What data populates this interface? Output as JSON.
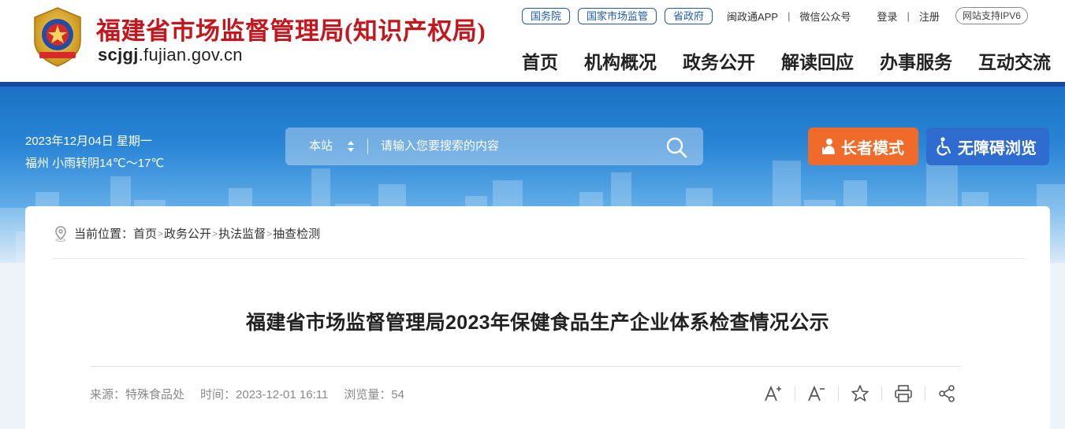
{
  "site": {
    "title": "福建省市场监督管理局(知识产权局)",
    "domain_a": "scjgj",
    "domain_b": ".fujian.gov.cn"
  },
  "toplinks": {
    "pills": [
      "国务院",
      "国家市场监管",
      "省政府"
    ],
    "app": "闽政通APP",
    "wechat": "微信公众号",
    "login": "登录",
    "register": "注册",
    "ipv6": "网站支持IPV6",
    "sep": "|"
  },
  "nav": [
    "首页",
    "机构概况",
    "政务公开",
    "解读回应",
    "办事服务",
    "互动交流"
  ],
  "banner": {
    "date": "2023年12月04日 星期一",
    "weather": "福州 小雨转阴14℃～17℃",
    "search_scope": "本站",
    "search_placeholder": "请输入您要搜索的内容",
    "elder_mode": "长者模式",
    "accessible": "无障碍浏览"
  },
  "breadcrumb": {
    "prefix": "当前位置：",
    "items": [
      "首页",
      "政务公开",
      "执法监督",
      "抽查检测"
    ],
    "sep": ">"
  },
  "article": {
    "title": "福建省市场监督管理局2023年保健食品生产企业体系检查情况公示",
    "source": "来源：特殊食品处",
    "time": "时间：2023-12-01 16:11",
    "views": "浏览量：54"
  },
  "tools": [
    "font-larger-icon",
    "font-smaller-icon",
    "favorite-icon",
    "print-icon",
    "share-icon"
  ],
  "colors": {
    "brand_red": "#c4161c",
    "brand_blue": "#1f5bb0",
    "elder_orange": "#f06a2a",
    "access_blue": "#2f6ccf"
  }
}
